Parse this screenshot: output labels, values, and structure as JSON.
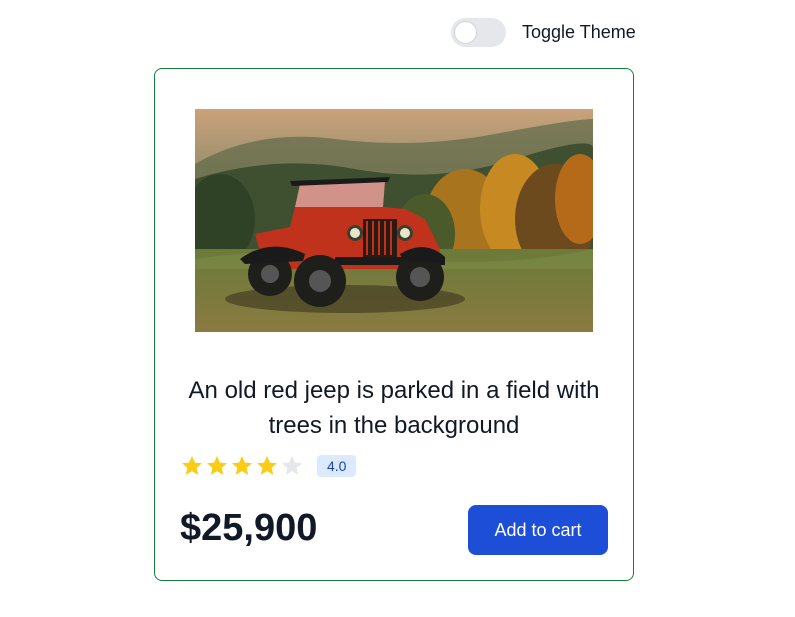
{
  "header": {
    "toggle_label": "Toggle Theme",
    "theme_toggle_on": false
  },
  "product": {
    "image_alt": "An old red jeep is parked in a field with trees in the background",
    "title": "An old red jeep is parked in a field with trees in the background",
    "rating_value": 4,
    "rating_max": 5,
    "rating_badge": "4.0",
    "price": "$25,900",
    "add_to_cart_label": "Add to cart"
  },
  "colors": {
    "card_border": "#15803d",
    "star_filled": "#facc15",
    "star_empty": "#e5e7eb",
    "badge_bg": "#dbeafe",
    "badge_text": "#1e40af",
    "button_bg": "#1d4ed8"
  },
  "icons": {
    "star": "star-icon"
  }
}
